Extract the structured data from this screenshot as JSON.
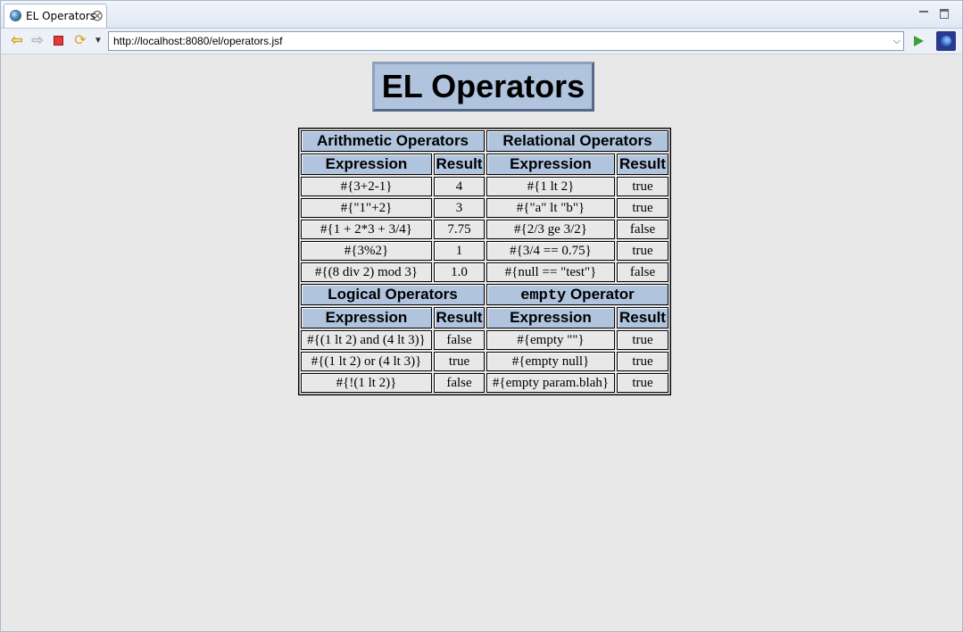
{
  "tab": {
    "title": "EL Operators"
  },
  "toolbar": {
    "url": "http://localhost:8080/el/operators.jsf"
  },
  "page": {
    "heading": "EL Operators"
  },
  "table": {
    "arithmetic": {
      "title": "Arithmetic Operators",
      "col_expr": "Expression",
      "col_result": "Result",
      "rows": [
        {
          "expr": "#{3+2-1}",
          "result": "4"
        },
        {
          "expr": "#{\"1\"+2}",
          "result": "3"
        },
        {
          "expr": "#{1 + 2*3 + 3/4}",
          "result": "7.75"
        },
        {
          "expr": "#{3%2}",
          "result": "1"
        },
        {
          "expr": "#{(8 div 2) mod 3}",
          "result": "1.0"
        }
      ]
    },
    "relational": {
      "title": "Relational Operators",
      "col_expr": "Expression",
      "col_result": "Result",
      "rows": [
        {
          "expr": "#{1 lt 2}",
          "result": "true"
        },
        {
          "expr": "#{\"a\" lt \"b\"}",
          "result": "true"
        },
        {
          "expr": "#{2/3 ge 3/2}",
          "result": "false"
        },
        {
          "expr": "#{3/4 == 0.75}",
          "result": "true"
        },
        {
          "expr": "#{null == \"test\"}",
          "result": "false"
        }
      ]
    },
    "logical": {
      "title": "Logical Operators",
      "col_expr": "Expression",
      "col_result": "Result",
      "rows": [
        {
          "expr": "#{(1 lt 2) and (4 lt 3)}",
          "result": "false"
        },
        {
          "expr": "#{(1 lt 2) or (4 lt 3)}",
          "result": "true"
        },
        {
          "expr": "#{!(1 lt 2)}",
          "result": "false"
        }
      ]
    },
    "empty": {
      "title_code": "empty",
      "title_rest": " Operator",
      "col_expr": "Expression",
      "col_result": "Result",
      "rows": [
        {
          "expr": "#{empty \"\"}",
          "result": "true"
        },
        {
          "expr": "#{empty null}",
          "result": "true"
        },
        {
          "expr": "#{empty param.blah}",
          "result": "true"
        }
      ]
    }
  },
  "icons": {
    "tab": "globe-icon",
    "close": "close-icon",
    "back": "back-arrow-icon",
    "forward": "forward-arrow-icon",
    "stop": "stop-icon",
    "refresh": "refresh-icon",
    "go": "go-icon"
  }
}
